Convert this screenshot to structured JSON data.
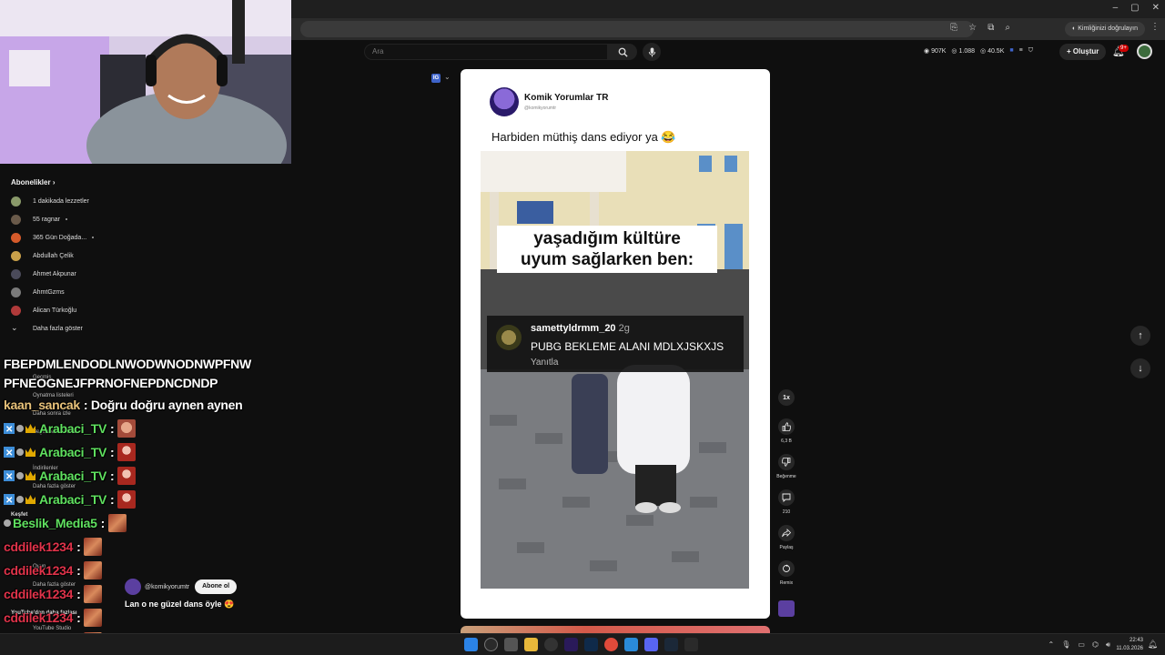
{
  "browser": {
    "verify_label": "Kimliğinizi doğrulayın",
    "window_controls": [
      "–",
      "▢",
      "✕"
    ]
  },
  "youtube": {
    "search_placeholder": "Ara",
    "stats": {
      "subs": "907K",
      "views": "1.088",
      "other": "40.5K"
    },
    "create_label": "Oluştur",
    "notifications_badge": "9+"
  },
  "sidebar": {
    "header": "Abonelikler",
    "items": [
      {
        "label": "1 dakikada lezzetler",
        "color": "#8a9a6a",
        "dot": false
      },
      {
        "label": "55 ragnar",
        "color": "#6a5a4a",
        "dot": true
      },
      {
        "label": "365 Gün Doğada...",
        "color": "#d55a2a",
        "dot": true
      },
      {
        "label": "Abdullah Çelik",
        "color": "#c9a04a",
        "dot": false
      },
      {
        "label": "Ahmet Akpunar",
        "color": "#4a4a5a",
        "dot": false
      },
      {
        "label": "AhmtGzms",
        "color": "#7a7a7a",
        "dot": false
      },
      {
        "label": "Alican Türkoğlu",
        "color": "#b03a3a",
        "dot": false
      },
      {
        "label": "Daha fazla göster",
        "color": "",
        "dot": false
      }
    ],
    "faint_items": [
      "Geçmiş",
      "Oynatma listeleri",
      "Daha sonra izle",
      "Beğenilen videolar",
      "İndirilenler",
      "Daha fazla göster",
      "Keşfet",
      "Oyun",
      "Daha fazla göster",
      "YouTube'dan daha fazlası",
      "YouTube Studio"
    ]
  },
  "chat": {
    "plain_lines": [
      "FBEPDMLENDODLNWODWNODNWPFNW",
      "PFNEOGNEJFPRNOFNEPDNCDNDP"
    ],
    "lines": [
      {
        "user": "kaan_sancak",
        "color": "#e8c27a",
        "message": ": Doğru doğru aynen aynen",
        "badges": [],
        "emote": ""
      },
      {
        "user": "Arabaci_TV",
        "color": "#5fe05f",
        "message": ":",
        "badges": [
          "x",
          "gear",
          "crown"
        ],
        "emote": "face"
      },
      {
        "user": "Arabaci_TV",
        "color": "#5fe05f",
        "message": ":",
        "badges": [
          "x",
          "gear",
          "crown"
        ],
        "emote": "red"
      },
      {
        "user": "Arabaci_TV",
        "color": "#5fe05f",
        "message": ":",
        "badges": [
          "x",
          "gear",
          "crown"
        ],
        "emote": "red"
      },
      {
        "user": "Arabaci_TV",
        "color": "#5fe05f",
        "message": ":",
        "badges": [
          "x",
          "gear",
          "crown"
        ],
        "emote": "red"
      },
      {
        "user": "Beslik_Media5",
        "color": "#5fe05f",
        "message": ":",
        "badges": [
          "gear"
        ],
        "emote": "cd"
      },
      {
        "user": "cddilek1234",
        "color": "#e0334a",
        "message": ":",
        "badges": [],
        "emote": "cd"
      },
      {
        "user": "cddilek1234",
        "color": "#e0334a",
        "message": ":",
        "badges": [],
        "emote": "cd"
      },
      {
        "user": "cddilek1234",
        "color": "#e0334a",
        "message": ":",
        "badges": [],
        "emote": "cd"
      },
      {
        "user": "cddilek1234",
        "color": "#e0334a",
        "message": ":",
        "badges": [],
        "emote": "cd"
      },
      {
        "user": "cddilek1234",
        "color": "#e0334a",
        "message": ":",
        "badges": [],
        "emote": "cd"
      }
    ]
  },
  "shorts": {
    "channel_handle": "@komikyorumtr",
    "subscribe_label": "Abone ol",
    "caption": "Lan o ne güzel dans öyle",
    "caption_emoji": "😍"
  },
  "card": {
    "badge": "IG",
    "channel_name": "Komik Yorumlar TR",
    "channel_handle": "@komikyorumtr",
    "caption": "Harbiden müthiş dans ediyor ya 😂",
    "meme_line1": "yaşadığım kültüre",
    "meme_line2": "uyum sağlarken ben:",
    "reply_user": "samettyldrmm_20",
    "reply_time": "2g",
    "reply_text": "PUBG BEKLEME ALANI MDLXJSKXJS",
    "reply_action": "Yanıtla"
  },
  "rail": {
    "speed": "1x",
    "likes": "6,3 B",
    "dislike_label": "Beğenme",
    "comments": "210",
    "share_label": "Paylaş",
    "remix_label": "Remix"
  },
  "taskbar": {
    "time": "22:43",
    "date": "11.03.2026"
  },
  "colors": {
    "background": "#0f0f0f",
    "card": "#ffffff",
    "accent_red": "#cc0000",
    "chat_green": "#5fe05f",
    "chat_red": "#e0334a"
  }
}
